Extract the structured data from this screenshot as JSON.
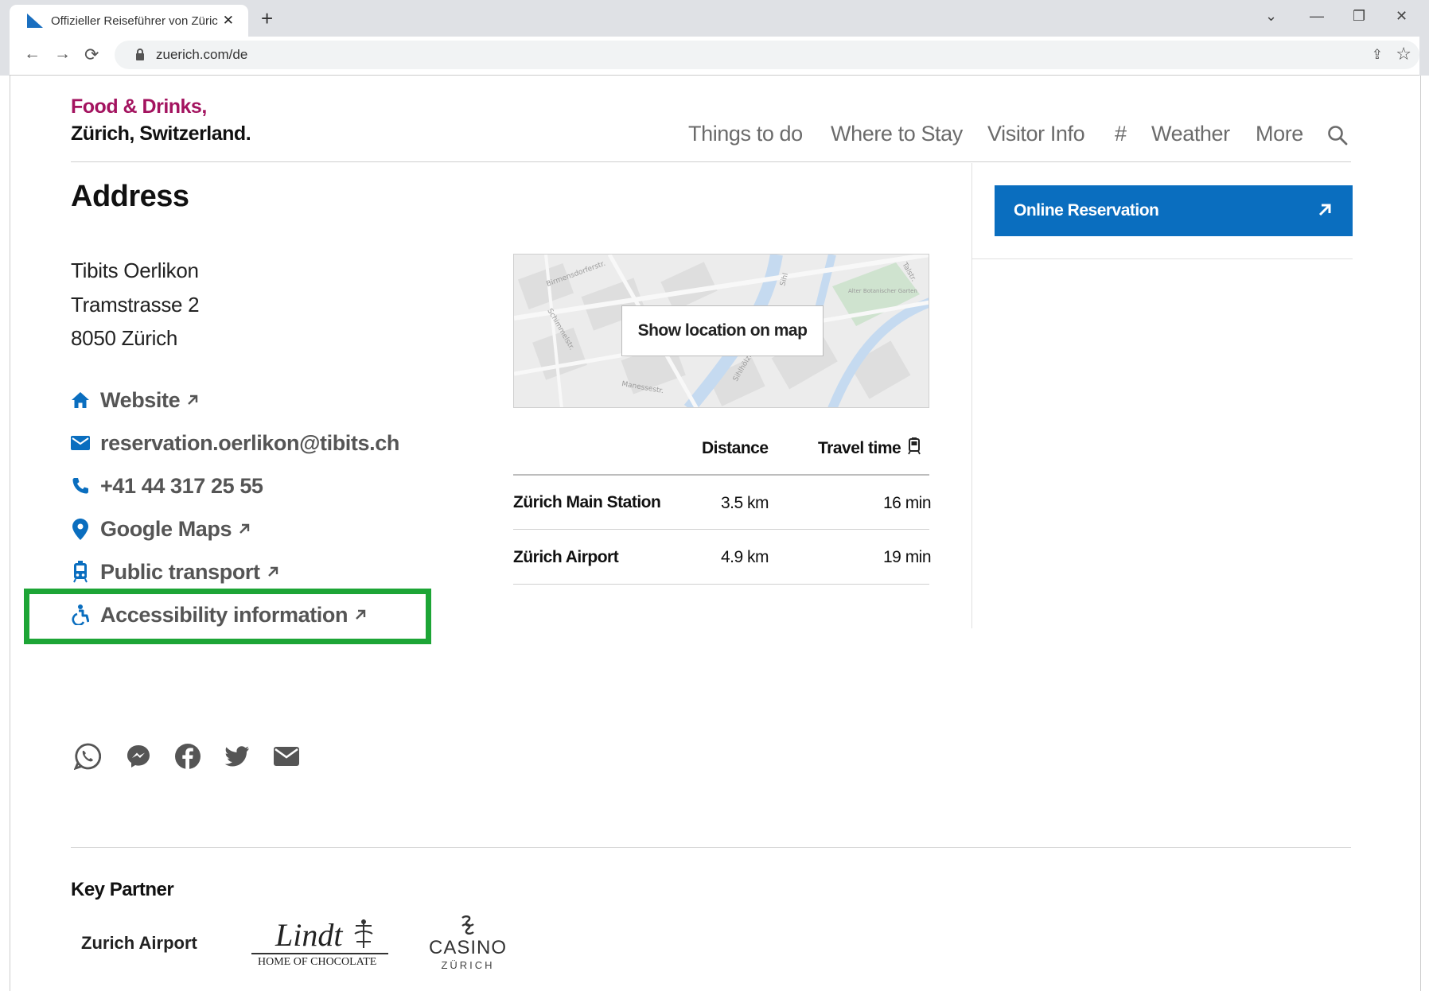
{
  "browser": {
    "tab_title": "Offizieller Reiseführer von Zürich",
    "url": "zuerich.com/de"
  },
  "site": {
    "brand_line1": "Food & Drinks,",
    "brand_line2": "Zürich, Switzerland.",
    "nav": [
      "Things to do",
      "Where to Stay",
      "Visitor Info",
      "#",
      "Weather",
      "More"
    ]
  },
  "address": {
    "heading": "Address",
    "lines": [
      "Tibits Oerlikon",
      "Tramstrasse 2",
      "8050 Zürich"
    ],
    "links": [
      {
        "label": "Website",
        "icon": "home-icon"
      },
      {
        "label": "reservation.oerlikon@tibits.ch",
        "icon": "mail-icon"
      },
      {
        "label": "+41 44 317 25 55",
        "icon": "phone-icon"
      },
      {
        "label": "Google Maps",
        "icon": "map-pin-icon"
      },
      {
        "label": "Public transport",
        "icon": "tram-icon"
      },
      {
        "label": "Accessibility information",
        "icon": "accessibility-icon"
      }
    ]
  },
  "map": {
    "button_label": "Show location on map",
    "street_labels": [
      "Birmensdorferstr.",
      "Schimmelstr.",
      "Manessestr.",
      "Sihlhölzli",
      "Sihl",
      "Talstr.",
      "Alter Botanischer Garten"
    ]
  },
  "distance_table": {
    "headers": [
      "Distance",
      "Travel time"
    ],
    "rows": [
      {
        "place": "Zürich Main Station",
        "distance": "3.5 km",
        "time": "16 min"
      },
      {
        "place": "Zürich Airport",
        "distance": "4.9 km",
        "time": "19 min"
      }
    ]
  },
  "sidebar": {
    "reservation_label": "Online Reservation"
  },
  "share_icons": [
    "whatsapp-icon",
    "messenger-icon",
    "facebook-icon",
    "twitter-icon",
    "mail-icon"
  ],
  "footer": {
    "key_partner_heading": "Key Partner",
    "partners": {
      "airport": "Zurich Airport",
      "lindt_word": "Lindt",
      "lindt_sub": "HOME OF CHOCOLATE",
      "casino_word": "CASINO",
      "casino_sub": "ZÜRICH"
    }
  },
  "colors": {
    "brand_magenta": "#a3135f",
    "link_blue": "#0a6ebf",
    "highlight_green": "#1da536"
  }
}
